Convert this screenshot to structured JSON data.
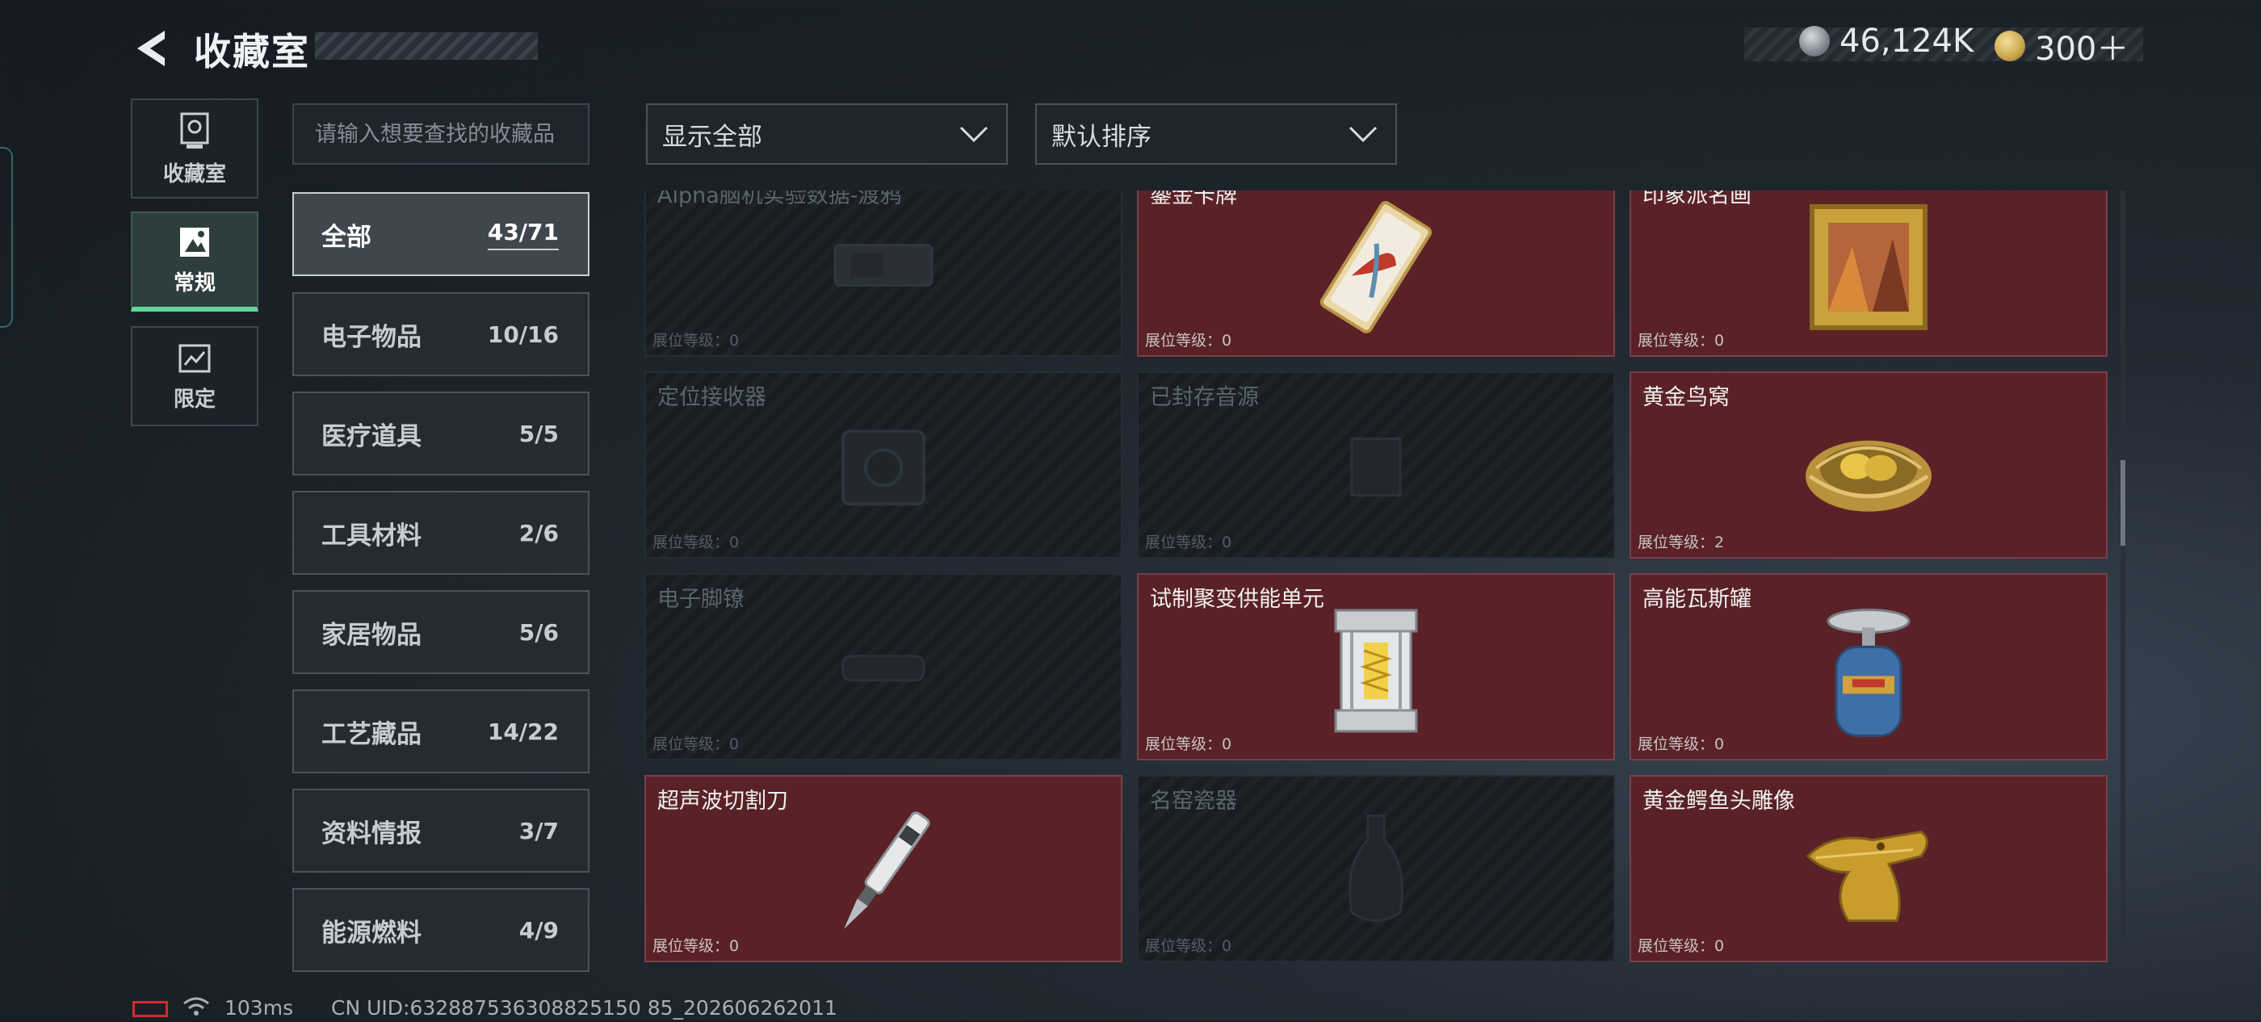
{
  "header": {
    "title": "收藏室"
  },
  "currency": {
    "silver_amount": "46,124K",
    "gold_amount": "300＋",
    "silver_color": "#9aa3ab",
    "gold_color": "#c9a64a"
  },
  "rail": [
    {
      "label": "收藏室",
      "icon": "trophy-icon"
    },
    {
      "label": "常规",
      "icon": "painting-icon",
      "active": true
    },
    {
      "label": "限定",
      "icon": "ticket-icon"
    }
  ],
  "search": {
    "placeholder": "请输入想要查找的收藏品",
    "value": ""
  },
  "categories": [
    {
      "name": "全部",
      "count": "43/71",
      "active": true
    },
    {
      "name": "电子物品",
      "count": "10/16"
    },
    {
      "name": "医疗道具",
      "count": "5/5"
    },
    {
      "name": "工具材料",
      "count": "2/6"
    },
    {
      "name": "家居物品",
      "count": "5/6"
    },
    {
      "name": "工艺藏品",
      "count": "14/22"
    },
    {
      "name": "资料情报",
      "count": "3/7"
    },
    {
      "name": "能源燃料",
      "count": "4/9"
    }
  ],
  "filters": {
    "display": "显示全部",
    "sort": "默认排序"
  },
  "items": [
    {
      "name": "Alpha脑机实验数据-渡鸦",
      "level": "展位等级：0",
      "owned": false,
      "icon": "data-drive-icon"
    },
    {
      "name": "鎏金卡牌",
      "level": "展位等级：0",
      "owned": true,
      "icon": "gilded-card-icon"
    },
    {
      "name": "印象派名画",
      "level": "展位等级：0",
      "owned": true,
      "icon": "framed-painting-icon"
    },
    {
      "name": "定位接收器",
      "level": "展位等级：0",
      "owned": false,
      "icon": "receiver-icon"
    },
    {
      "name": "已封存音源",
      "level": "展位等级：0",
      "owned": false,
      "icon": "sound-source-icon"
    },
    {
      "name": "黄金鸟窝",
      "level": "展位等级：2",
      "owned": true,
      "icon": "golden-nest-icon"
    },
    {
      "name": "电子脚镣",
      "level": "展位等级：0",
      "owned": false,
      "icon": "ankle-monitor-icon"
    },
    {
      "name": "试制聚变供能单元",
      "level": "展位等级：0",
      "owned": true,
      "icon": "fusion-cell-icon"
    },
    {
      "name": "高能瓦斯罐",
      "level": "展位等级：0",
      "owned": true,
      "icon": "gas-canister-icon"
    },
    {
      "name": "超声波切割刀",
      "level": "展位等级：0",
      "owned": true,
      "icon": "ultrasonic-cutter-icon"
    },
    {
      "name": "名窑瓷器",
      "level": "展位等级：0",
      "owned": false,
      "icon": "porcelain-vase-icon"
    },
    {
      "name": "黄金鳄鱼头雕像",
      "level": "展位等级：0",
      "owned": true,
      "icon": "golden-crocodile-icon"
    }
  ],
  "status": {
    "ping": "103ms",
    "uid": "CN UID:632887536308825150 85_202606262011"
  }
}
